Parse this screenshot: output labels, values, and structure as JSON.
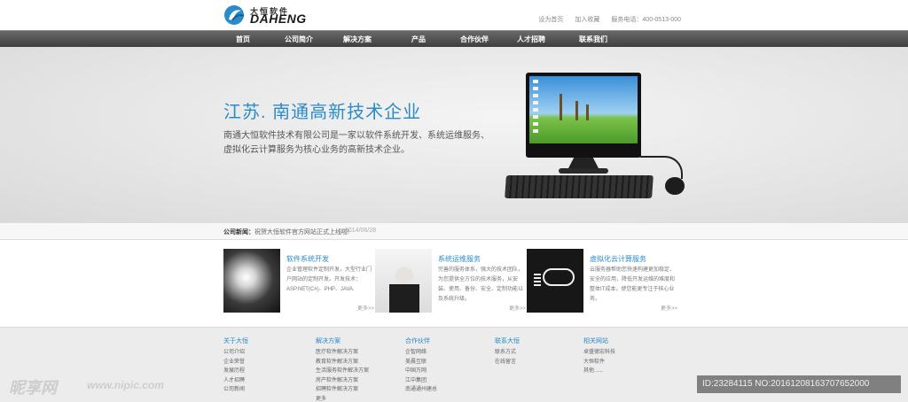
{
  "header": {
    "logo_cn": "大恒软件",
    "logo_en": "DAHENG",
    "links": [
      "设为首页",
      "加入收藏",
      "服务电话：400-0513-000"
    ]
  },
  "nav": {
    "items": [
      "首页",
      "公司简介",
      "解决方案",
      "产品",
      "合作伙伴",
      "人才招聘",
      "联系我们"
    ]
  },
  "banner": {
    "headline": "江苏. 南通高新技术企业",
    "intro": "南通大恒软件技术有限公司是一家以软件系统开发、系统运维服务、虚拟化云计算服务为核心业务的高新技术企业。"
  },
  "news": {
    "label": "公司新闻：",
    "text": "祝贺大恒软件官方网站正式上线啦!",
    "date": "2014/06/28"
  },
  "features": [
    {
      "title": "软件系统开发",
      "desc": "企业管理软件定制开发，大型行业门户网站的定制开发。开发技术：ASP.NET(C#)、PHP、JAVA.",
      "more": "更多>>"
    },
    {
      "title": "系统运维服务",
      "desc": "完善的服务体系，强大的技术团队，为您提供全方位的技术服务，从安装、使用、备份、安全、定制功能以及系统升级。",
      "more": "更多>>"
    },
    {
      "title": "虚拟化云计算服务",
      "desc": "云服务器帮助您快速构建更加稳定、安全的应用，降低开发运维的难度和整体IT成本，使您能更专注于核心业务。",
      "more": "更多>>"
    }
  ],
  "footer": {
    "columns": [
      {
        "title": "关于大恒",
        "links": [
          "公司介绍",
          "企业荣誉",
          "发展历程",
          "人才招聘",
          "公司新闻"
        ]
      },
      {
        "title": "解决方案",
        "links": [
          "医疗软件解决方案",
          "教育软件解决方案",
          "生活服务软件解决方案",
          "房产软件解决方案",
          "招聘软件解决方案",
          "更多"
        ]
      },
      {
        "title": "合作伙伴",
        "links": [
          "企智网络",
          "美晨互联",
          "中国万网",
          "江中集团",
          "南通通州建总"
        ]
      },
      {
        "title": "联系大恒",
        "links": [
          "联系方式",
          "在线留言"
        ]
      },
      {
        "title": "相关网站",
        "links": [
          "卓盛德宏科技",
          "大恒软件",
          "其他......"
        ]
      }
    ]
  },
  "watermark": {
    "left": "昵享网",
    "url": "www.nipic.com",
    "right": "ID:23284115 NO:20161208163707652000"
  },
  "colors": {
    "accent": "#2a8bc9",
    "nav_bg": "#4a4a4a"
  }
}
